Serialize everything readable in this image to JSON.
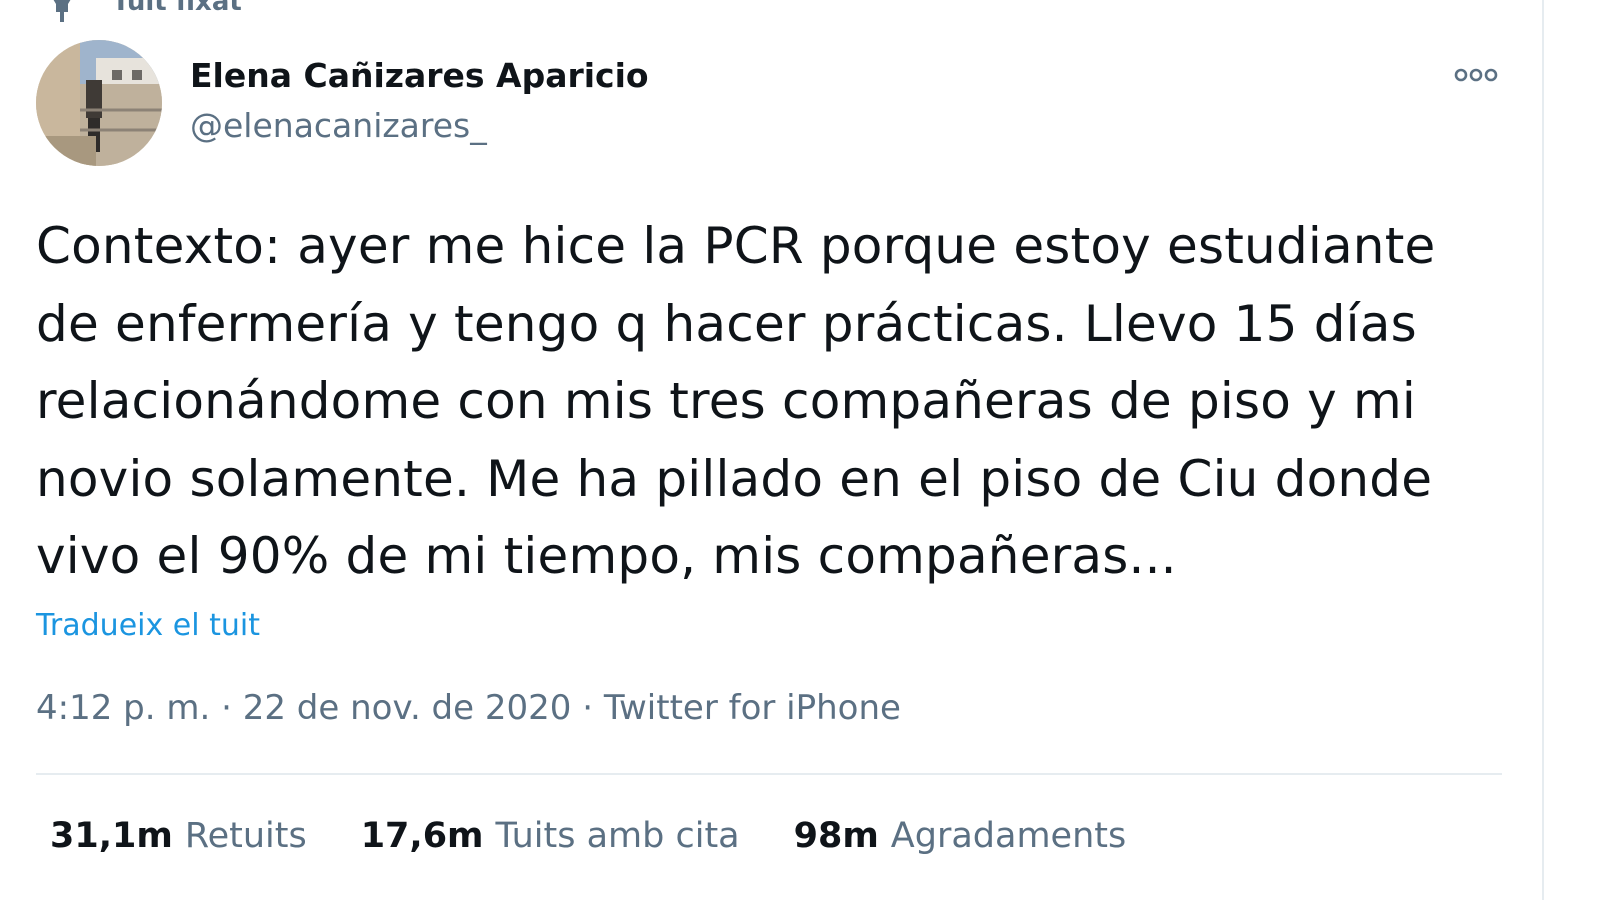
{
  "pinned": {
    "label": "Tuit fixat",
    "icon": "pin-icon"
  },
  "author": {
    "name": "Elena Cañizares Aparicio",
    "handle": "@elenacanizares_",
    "avatar": "avatar"
  },
  "more_menu": {
    "icon": "more-dots-icon"
  },
  "tweet": {
    "text": "Contexto: ayer me hice la PCR porque estoy estudiante\nde enfermería y tengo q hacer prácticas. Llevo 15 días\nrelacionándome con mis tres compañeras de piso y mi\nnovio solamente. Me ha pillado en el piso de Ciu donde\nvivo el 90% de mi tiempo, mis compañeras...",
    "translate_label": "Tradueix el tuit"
  },
  "meta": {
    "time": "4:12 p. m.",
    "separator": " · ",
    "date": "22 de nov. de 2020",
    "source": "Twitter for iPhone"
  },
  "stats": {
    "retweets": {
      "count": "31,1m",
      "label": "Retuits"
    },
    "quotes": {
      "count": "17,6m",
      "label": "Tuits amb cita"
    },
    "likes": {
      "count": "98m",
      "label": "Agradaments"
    }
  },
  "colors": {
    "text_primary": "#0f1419",
    "text_secondary": "#5b7083",
    "link": "#1b95e0",
    "divider": "#e6ecf0"
  }
}
